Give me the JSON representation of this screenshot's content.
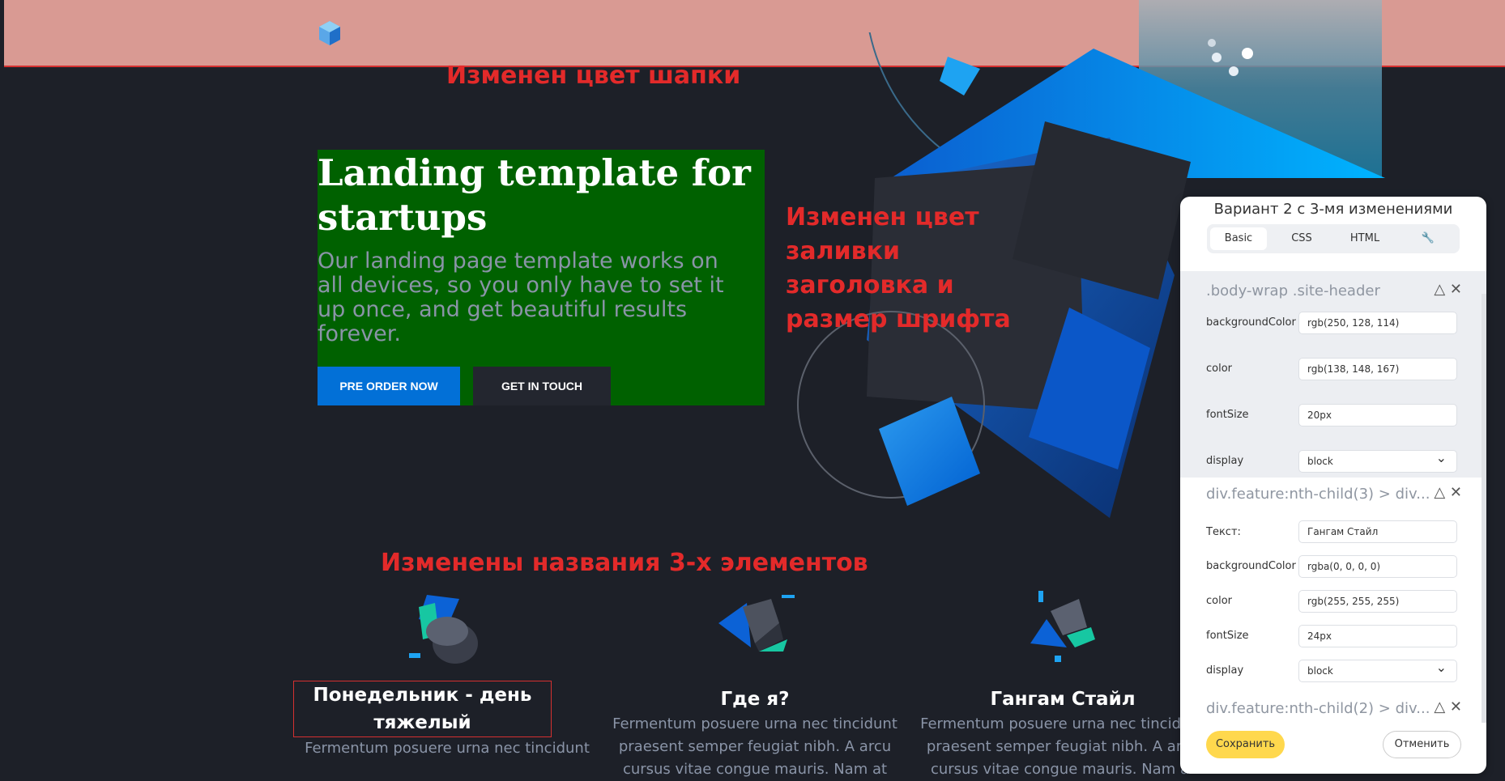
{
  "annotations": {
    "header_changed": "Изменен цвет шапки",
    "fill_changed": "Изменен цвет заливки заголовка и размер шрифта",
    "names_changed": "Изменены названия 3-х элементов"
  },
  "hero": {
    "title": "Landing template for startups",
    "subtitle": "Our landing page template works on all devices, so you only have to set it up once, and get beautiful results forever.",
    "primary_button": "PRE ORDER NOW",
    "secondary_button": "GET IN TOUCH"
  },
  "features": [
    {
      "title": "Понедельник - день тяжелый",
      "text": "Fermentum posuere urna nec tincidunt"
    },
    {
      "title": "Где я?",
      "text": "Fermentum posuere urna nec tincidunt praesent semper feugiat nibh. A arcu cursus vitae congue mauris. Nam at"
    },
    {
      "title": "Гангам Стайл",
      "text": "Fermentum posuere urna nec tincidunt praesent semper feugiat nibh. A arcu cursus vitae congue mauris. Nam at"
    }
  ],
  "panel": {
    "title": "Вариант 2 с 3-мя изменениями",
    "tabs": [
      "Basic",
      "CSS",
      "HTML",
      "🔧"
    ],
    "sections": [
      {
        "selector": ".body-wrap .site-header",
        "rows": [
          {
            "label": "backgroundColor",
            "value": "rgb(250, 128, 114)"
          },
          {
            "label": "color",
            "value": "rgb(138, 148, 167)"
          },
          {
            "label": "fontSize",
            "value": "20px"
          },
          {
            "label": "display",
            "value": "block"
          }
        ]
      },
      {
        "selector": "div.feature:nth-child(3) > div...",
        "rows": [
          {
            "label": "Текст:",
            "value": "Гангам Стайл"
          },
          {
            "label": "backgroundColor",
            "value": "rgba(0, 0, 0, 0)"
          },
          {
            "label": "color",
            "value": "rgb(255, 255, 255)"
          },
          {
            "label": "fontSize",
            "value": "24px"
          },
          {
            "label": "display",
            "value": "block"
          }
        ]
      },
      {
        "selector": "div.feature:nth-child(2) > div..."
      }
    ],
    "actions_icons": "△ ✕",
    "save": "Сохранить",
    "cancel": "Отменить"
  },
  "colors": {
    "header_bg": "#d99a93",
    "hero_fill": "#006100",
    "primary": "#0270d7",
    "annotation": "#e32a2a"
  }
}
